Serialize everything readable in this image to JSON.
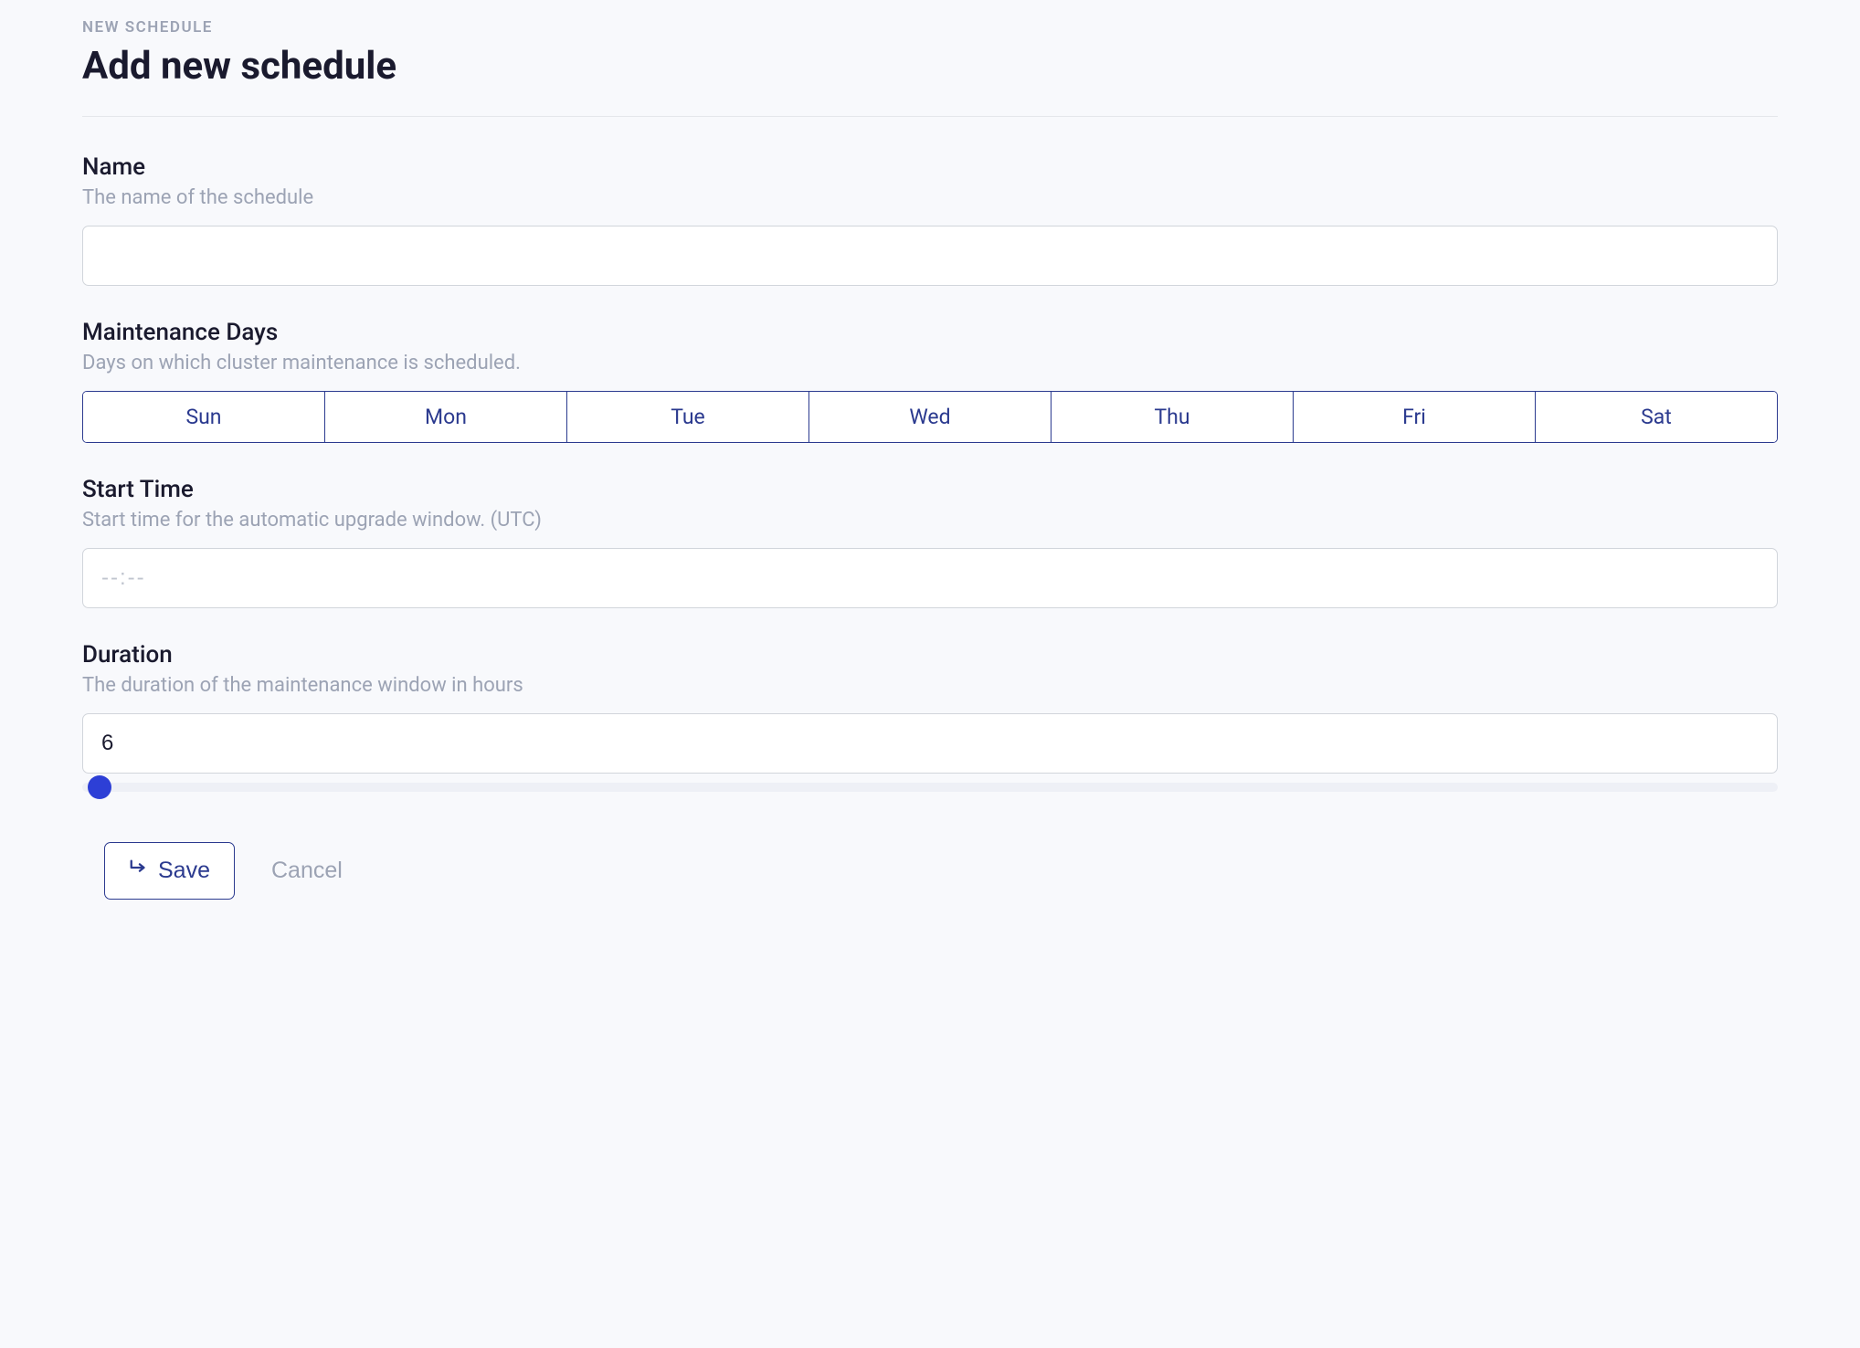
{
  "breadcrumb": "NEW SCHEDULE",
  "page_title": "Add new schedule",
  "fields": {
    "name": {
      "label": "Name",
      "description": "The name of the schedule",
      "value": ""
    },
    "maintenance_days": {
      "label": "Maintenance Days",
      "description": "Days on which cluster maintenance is scheduled.",
      "options": [
        "Sun",
        "Mon",
        "Tue",
        "Wed",
        "Thu",
        "Fri",
        "Sat"
      ]
    },
    "start_time": {
      "label": "Start Time",
      "description": "Start time for the automatic upgrade window. (UTC)",
      "placeholder": "--:--",
      "value": ""
    },
    "duration": {
      "label": "Duration",
      "description": "The duration of the maintenance window in hours",
      "value": "6"
    }
  },
  "buttons": {
    "save": "Save",
    "cancel": "Cancel"
  }
}
